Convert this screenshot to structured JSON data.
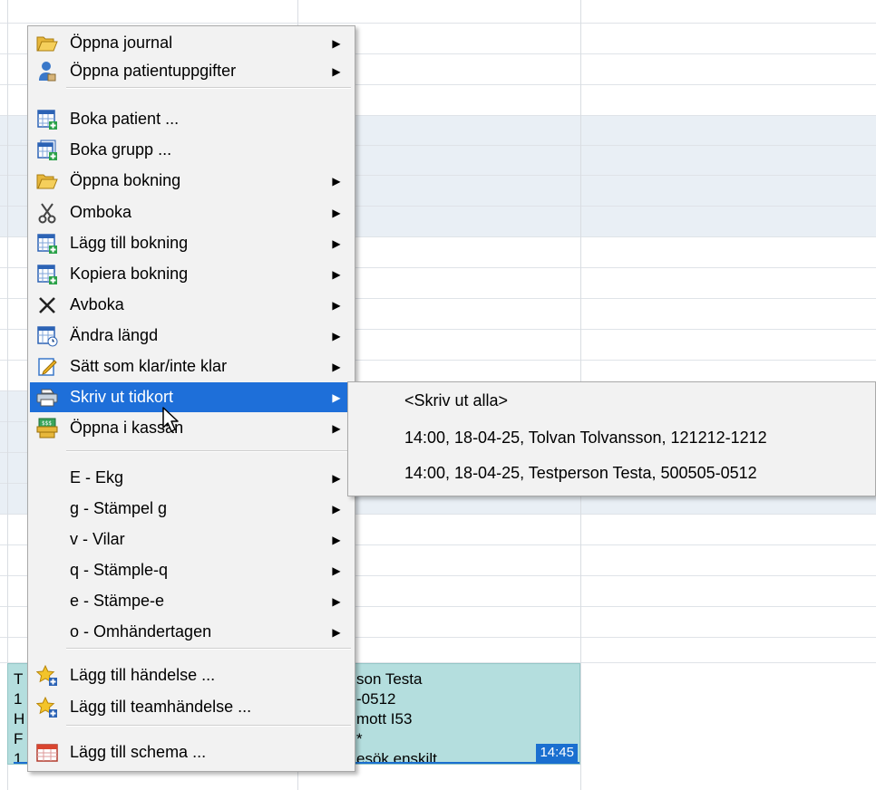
{
  "menu": {
    "items": [
      {
        "label": "Öppna journal",
        "icon": "open-folder-icon",
        "submenu": true
      },
      {
        "label": "Öppna patientuppgifter",
        "icon": "person-icon",
        "submenu": true
      },
      {
        "label": "Boka patient ...",
        "icon": "calendar-add-icon",
        "submenu": false
      },
      {
        "label": "Boka grupp ...",
        "icon": "calendar-group-icon",
        "submenu": false
      },
      {
        "label": "Öppna bokning",
        "icon": "open-folder-icon",
        "submenu": true
      },
      {
        "label": "Omboka",
        "icon": "scissors-icon",
        "submenu": true
      },
      {
        "label": "Lägg till bokning",
        "icon": "calendar-add-icon",
        "submenu": true
      },
      {
        "label": "Kopiera bokning",
        "icon": "calendar-add-icon",
        "submenu": true
      },
      {
        "label": "Avboka",
        "icon": "cross-icon",
        "submenu": true
      },
      {
        "label": "Ändra längd",
        "icon": "calendar-clock-icon",
        "submenu": true
      },
      {
        "label": "Sätt som klar/inte klar",
        "icon": "pencil-note-icon",
        "submenu": true
      },
      {
        "label": "Skriv ut tidkort",
        "icon": "printer-icon",
        "submenu": true
      },
      {
        "label": "Öppna i kassan",
        "icon": "cash-register-icon",
        "submenu": true
      },
      {
        "label": "E - Ekg",
        "submenu": true
      },
      {
        "label": "g - Stämpel g",
        "submenu": true
      },
      {
        "label": "v - Vilar",
        "submenu": true
      },
      {
        "label": "q - Stämple-q",
        "submenu": true
      },
      {
        "label": "e - Stämpe-e",
        "submenu": true
      },
      {
        "label": "o - Omhändertagen",
        "submenu": true
      },
      {
        "label": "Lägg till händelse ...",
        "icon": "star-add-icon",
        "submenu": false
      },
      {
        "label": "Lägg till teamhändelse ...",
        "icon": "star-add-icon",
        "submenu": false
      },
      {
        "label": "Lägg till schema ...",
        "icon": "schedule-icon",
        "submenu": false
      }
    ],
    "highlighted_index": 11
  },
  "submenu": {
    "items": [
      "<Skriv ut alla>",
      "14:00, 18-04-25, Tolvan Tolvansson, 121212-1212",
      "14:00, 18-04-25, Testperson Testa, 500505-0512"
    ]
  },
  "booking": {
    "left_text": "T\n1\nH\nF\n1",
    "right_text": "son Testa\n-0512\nmott I53\n*\nesök enskilt",
    "time": "14:45"
  },
  "colors": {
    "highlight": "#1e6fd9",
    "booking_bg": "#b4dede",
    "menu_bg": "#f2f2f2"
  }
}
